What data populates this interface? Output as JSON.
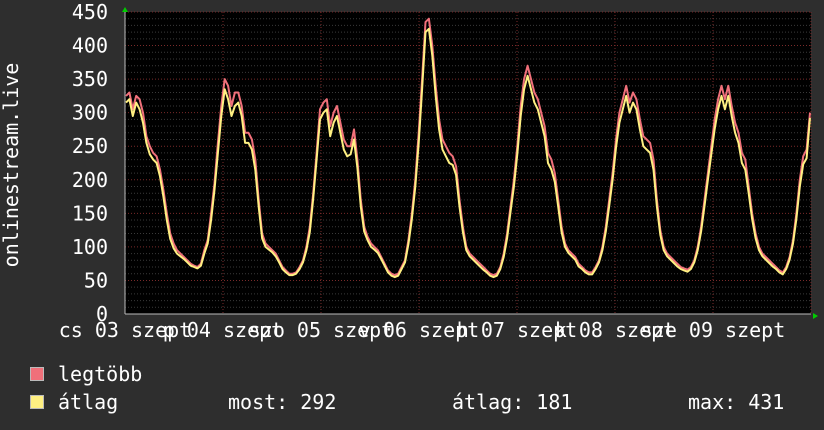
{
  "chart_data": {
    "type": "line",
    "title": "",
    "ylabel": "onlinestream.live",
    "xlabel": "",
    "ylim": [
      0,
      450
    ],
    "yticks": [
      0,
      50,
      100,
      150,
      200,
      250,
      300,
      350,
      400,
      450
    ],
    "x_tick_labels": [
      "cs 03 szept",
      "p 04 szept",
      "szo 05 szept",
      "v 06 szept",
      "h 07 szept",
      "k 08 szept",
      "sze 09 szept"
    ],
    "grid": true,
    "legend_position": "bottom-left",
    "series": [
      {
        "name": "legtöbb",
        "color": "#f0707a",
        "values": [
          325,
          330,
          305,
          325,
          320,
          300,
          265,
          250,
          240,
          235,
          215,
          185,
          150,
          120,
          105,
          95,
          90,
          85,
          80,
          75,
          72,
          70,
          75,
          95,
          110,
          150,
          195,
          255,
          310,
          350,
          340,
          310,
          330,
          330,
          310,
          270,
          270,
          260,
          230,
          170,
          120,
          105,
          100,
          95,
          90,
          80,
          70,
          65,
          60,
          60,
          62,
          70,
          80,
          100,
          130,
          180,
          240,
          305,
          315,
          320,
          280,
          300,
          310,
          285,
          260,
          250,
          250,
          275,
          230,
          170,
          130,
          115,
          105,
          100,
          95,
          85,
          75,
          65,
          60,
          58,
          60,
          70,
          80,
          110,
          150,
          200,
          270,
          350,
          435,
          440,
          400,
          340,
          290,
          260,
          250,
          240,
          235,
          220,
          170,
          130,
          100,
          90,
          85,
          80,
          75,
          70,
          65,
          60,
          58,
          60,
          70,
          90,
          120,
          160,
          200,
          250,
          310,
          350,
          370,
          350,
          330,
          320,
          300,
          280,
          240,
          230,
          210,
          170,
          130,
          105,
          95,
          90,
          85,
          75,
          70,
          65,
          62,
          62,
          70,
          80,
          100,
          130,
          170,
          210,
          260,
          300,
          320,
          340,
          315,
          330,
          320,
          290,
          265,
          260,
          255,
          230,
          170,
          125,
          100,
          90,
          85,
          80,
          75,
          70,
          68,
          66,
          70,
          80,
          100,
          130,
          170,
          210,
          250,
          290,
          320,
          340,
          320,
          340,
          310,
          285,
          270,
          240,
          230,
          190,
          150,
          120,
          100,
          90,
          85,
          80,
          75,
          70,
          65,
          62,
          70,
          85,
          110,
          150,
          200,
          235,
          245,
          300
        ]
      },
      {
        "name": "átlag",
        "color": "#fff082",
        "values": [
          315,
          320,
          295,
          315,
          305,
          285,
          255,
          238,
          230,
          225,
          205,
          175,
          140,
          112,
          98,
          90,
          86,
          82,
          77,
          72,
          70,
          68,
          72,
          90,
          105,
          140,
          185,
          240,
          295,
          335,
          320,
          295,
          310,
          315,
          295,
          255,
          255,
          245,
          215,
          160,
          113,
          100,
          96,
          92,
          86,
          77,
          67,
          62,
          58,
          58,
          60,
          67,
          77,
          95,
          122,
          172,
          230,
          290,
          300,
          305,
          265,
          285,
          295,
          270,
          245,
          235,
          238,
          260,
          218,
          160,
          123,
          110,
          100,
          96,
          91,
          82,
          72,
          62,
          57,
          55,
          57,
          67,
          77,
          104,
          142,
          190,
          255,
          335,
          420,
          425,
          385,
          325,
          275,
          245,
          235,
          225,
          222,
          207,
          160,
          122,
          95,
          86,
          81,
          76,
          71,
          66,
          62,
          57,
          55,
          57,
          67,
          85,
          113,
          152,
          190,
          238,
          295,
          335,
          355,
          335,
          315,
          305,
          285,
          265,
          225,
          215,
          197,
          160,
          122,
          100,
          91,
          86,
          81,
          71,
          67,
          62,
          59,
          59,
          67,
          77,
          95,
          123,
          161,
          200,
          248,
          285,
          305,
          325,
          300,
          315,
          305,
          275,
          250,
          245,
          240,
          215,
          160,
          118,
          95,
          86,
          81,
          76,
          71,
          67,
          65,
          63,
          67,
          77,
          95,
          123,
          161,
          200,
          238,
          276,
          305,
          325,
          305,
          325,
          295,
          270,
          255,
          225,
          215,
          180,
          142,
          113,
          95,
          86,
          81,
          76,
          71,
          67,
          62,
          59,
          67,
          81,
          105,
          142,
          190,
          223,
          232,
          292
        ]
      }
    ]
  },
  "legend": [
    {
      "label": "legtöbb",
      "color": "#f0707a"
    },
    {
      "label": "átlag",
      "color": "#fff082"
    }
  ],
  "stats": {
    "most": "most: 292",
    "atlag": "átlag: 181",
    "max": "max: 431"
  }
}
